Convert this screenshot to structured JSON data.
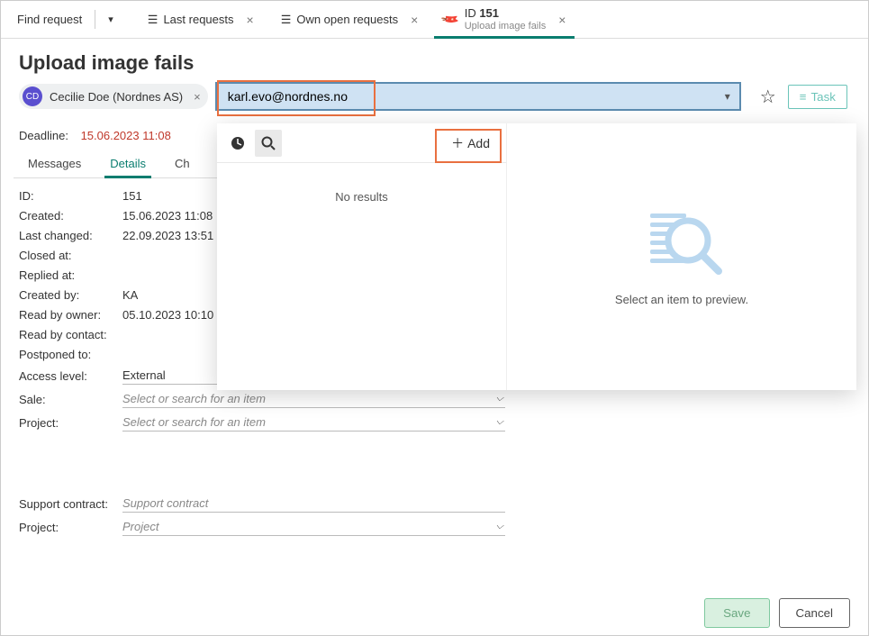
{
  "tabs": {
    "find_request": "Find request",
    "last_requests": "Last requests",
    "own_open": "Own open requests",
    "active_id_prefix": "ID",
    "active_id_num": "151",
    "active_sub": "Upload image fails"
  },
  "header": {
    "title": "Upload image fails",
    "contact_initials": "CD",
    "contact_label": "Cecilie Doe (Nordnes AS)",
    "input_value": "karl.evo@nordnes.no",
    "task_label": "Task"
  },
  "deadline": {
    "label": "Deadline:",
    "value": "15.06.2023 11:08"
  },
  "subtabs": {
    "messages": "Messages",
    "details": "Details",
    "third": "Ch"
  },
  "details": {
    "id": {
      "label": "ID:",
      "value": "151"
    },
    "created": {
      "label": "Created:",
      "value": "15.06.2023 11:08"
    },
    "last_changed": {
      "label": "Last changed:",
      "value": "22.09.2023 13:51"
    },
    "closed": {
      "label": "Closed at:",
      "value": ""
    },
    "replied": {
      "label": "Replied at:",
      "value": ""
    },
    "created_by": {
      "label": "Created by:",
      "value": "KA"
    },
    "read_by_owner": {
      "label": "Read by owner:",
      "value": "05.10.2023 10:10"
    },
    "read_by_contact": {
      "label": "Read by contact:",
      "value": ""
    },
    "postponed": {
      "label": "Postponed to:",
      "value": ""
    },
    "access": {
      "label": "Access level:",
      "value": "External"
    },
    "sale": {
      "label": "Sale:",
      "placeholder": "Select or search for an item"
    },
    "project": {
      "label": "Project:",
      "placeholder": "Select or search for an item"
    },
    "support_contract": {
      "label": "Support contract:",
      "placeholder": "Support contract"
    },
    "project2": {
      "label": "Project:",
      "placeholder": "Project"
    }
  },
  "popover": {
    "add_label": "Add",
    "no_results": "No results",
    "preview_hint": "Select an item to preview."
  },
  "footer": {
    "save": "Save",
    "cancel": "Cancel"
  }
}
